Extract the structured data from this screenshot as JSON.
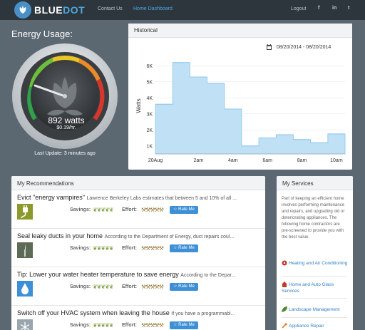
{
  "header": {
    "brand_a": "BLUE",
    "brand_b": "DOT",
    "nav": [
      "Contact Us",
      "Home Dashboard"
    ],
    "logout": "Logout",
    "social": [
      "f",
      "in",
      "t"
    ]
  },
  "energy": {
    "title": "Energy Usage:",
    "watts": "892 watts",
    "cost": "$0.19/hr.",
    "last_update": "Last Update: 3 minutes ago"
  },
  "historical": {
    "title": "Historical",
    "date_range": "08/20/2014 - 08/20/2014"
  },
  "chart_data": {
    "type": "area",
    "ylabel": "Watts",
    "xlabel": "",
    "x_tick_labels": [
      "20Aug",
      "2am",
      "4am",
      "6am",
      "8am",
      "10am"
    ],
    "y_tick_labels": [
      "1K",
      "2K",
      "3K",
      "4K",
      "5K",
      "6K"
    ],
    "ylim": [
      500,
      6500
    ],
    "step": true,
    "values": [
      3600,
      6200,
      5300,
      4900,
      3300,
      1000,
      1500,
      1700,
      1400,
      1200,
      1750
    ],
    "color": "#bfe0f5",
    "line_color": "#8cc6ec"
  },
  "recommendations": {
    "title": "My Recommendations",
    "savings_label": "Savings:",
    "effort_label": "Effort:",
    "rate_label": "☆ Rate Me",
    "items": [
      {
        "title": "Evict \"energy vampires\"",
        "desc": "Lawrence Berkeley Labs estimates that between 5 and 10% of all ...",
        "icon": "plug-icon",
        "icon_bg": "#8b9a2a"
      },
      {
        "title": "Seal leaky ducts in your home",
        "desc": "According to the Department of Energy, duct repairs coul...",
        "icon": "wind-turbine-icon",
        "icon_bg": "#5c6b55"
      },
      {
        "title": "Tip: Lower your water heater temperature to save energy",
        "desc": "According to the Depar...",
        "icon": "water-drop-icon",
        "icon_bg": "#3d8fd6"
      },
      {
        "title": "Switch off your HVAC system when leaving the house",
        "desc": "If you have a programmabl...",
        "icon": "snowflake-icon",
        "icon_bg": "#9aa6ad"
      }
    ]
  },
  "services": {
    "title": "My Services",
    "description": "Part of keeping an efficient home involves performing maintenance and repairs, and upgrading old or deteriorating appliances. The following home contractors are pre-screened to provide you with the best value.",
    "items": [
      {
        "label": "Heating and Air Conditioning",
        "icon": "fan-icon"
      },
      {
        "label": "Home and Auto Glass Services",
        "icon": "house-icon"
      },
      {
        "label": "Landscape Management",
        "icon": "leaf-icon"
      },
      {
        "label": "Appliance Repair",
        "icon": "wrench-icon"
      }
    ]
  }
}
